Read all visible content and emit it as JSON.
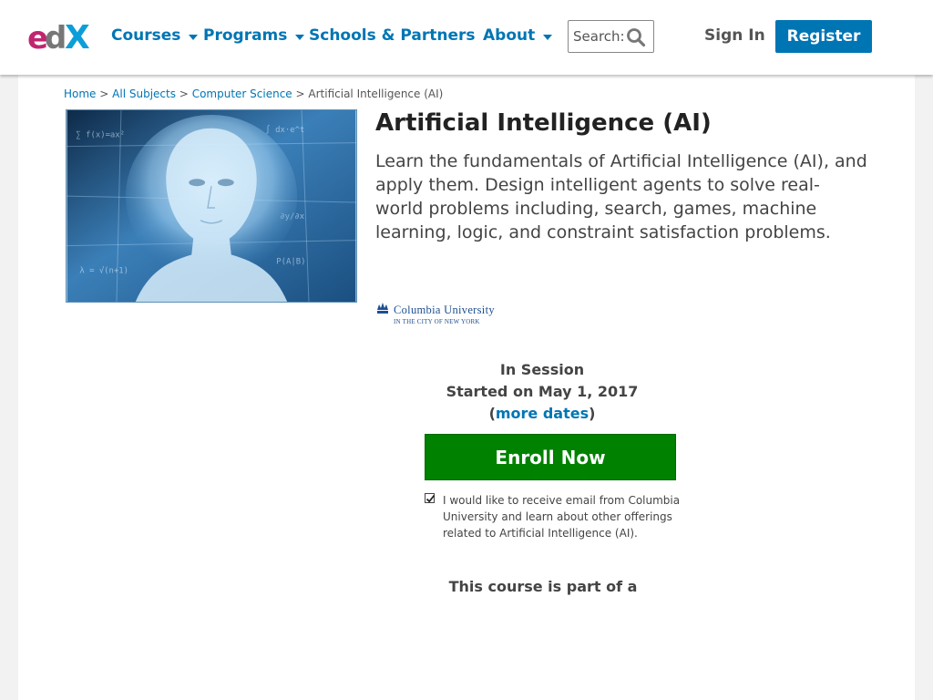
{
  "header": {
    "nav": [
      {
        "label": "Courses",
        "has_dropdown": true
      },
      {
        "label": "Programs",
        "has_dropdown": true
      },
      {
        "label": "Schools & Partners",
        "has_dropdown": false
      },
      {
        "label": "About",
        "has_dropdown": true
      }
    ],
    "search_label": "Search:",
    "signin_label": "Sign In",
    "register_label": "Register",
    "brand_color": "#0075b4"
  },
  "breadcrumb": {
    "home": "Home",
    "subjects": "All Subjects",
    "category": "Computer Science",
    "current": "Artificial Intelligence (AI)",
    "separator": ">"
  },
  "course": {
    "title": "Artificial Intelligence (AI)",
    "description": "Learn the fundamentals of Artificial Intelligence (AI), and apply them. Design intelligent agents to solve real-world problems including, search, games, machine learning, logic, and constraint satisfaction problems.",
    "school_name": "Columbia University",
    "school_tagline": "IN THE CITY OF NEW YORK",
    "status": "In Session",
    "start_text": "Started on May 1, 2017",
    "more_dates_open": "(",
    "more_dates_label": "more dates",
    "more_dates_close": ")",
    "enroll_label": "Enroll Now",
    "enroll_color": "#008100",
    "consent_checked": true,
    "consent_text": "I would like to receive email from Columbia University and learn about other offerings related to Artificial Intelligence (AI).",
    "part_of_text": "This course is part of a"
  }
}
